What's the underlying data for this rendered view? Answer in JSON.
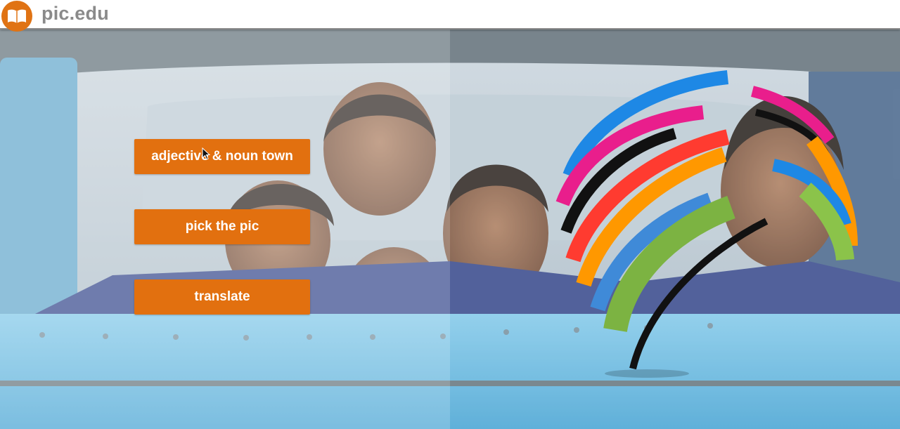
{
  "header": {
    "site_title": "pic.edu",
    "logo_icon": "open-book-icon"
  },
  "menu": {
    "items": [
      {
        "label": "adjective & noun town"
      },
      {
        "label": "pick the pic"
      },
      {
        "label": "translate"
      }
    ]
  },
  "colors": {
    "accent": "#e2700f",
    "logo_bg": "#e07314",
    "title_text": "#8a8a8a",
    "button_text": "#ffffff"
  },
  "background": {
    "description_icon": "photo-background"
  },
  "brand_graphic": {
    "icon": "striped-globe-logo-icon",
    "stripe_colors": [
      "#1e88e5",
      "#e91e8c",
      "#111111",
      "#8bc34a",
      "#ff3b30",
      "#ff9800",
      "#ffc107",
      "#3f8ad8",
      "#7cb342"
    ]
  }
}
